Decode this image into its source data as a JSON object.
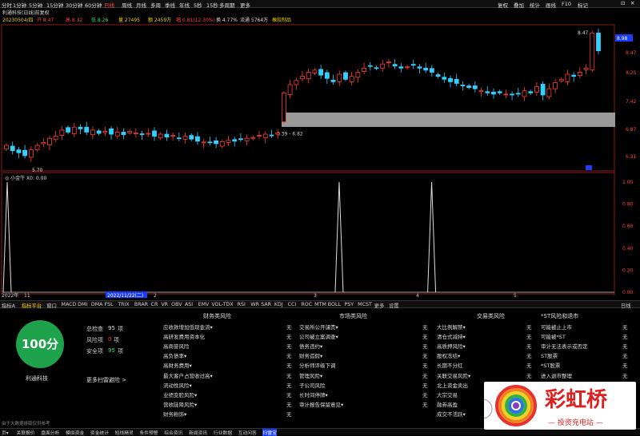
{
  "topbar": {
    "items": [
      "分时",
      "1分钟",
      "5分钟",
      "15分钟",
      "30分钟",
      "60分钟",
      "日线",
      "周线",
      "月线",
      "多周",
      "季线",
      "年线",
      "5秒",
      "15秒",
      "多周期",
      "更多"
    ],
    "selected": 6,
    "right_items": [
      "复权",
      "叠加",
      "统计",
      "画线",
      "F10",
      "标记"
    ]
  },
  "info": {
    "title": "利通科技(日线)前复权",
    "date": "20230504/四",
    "open": "开 8.47",
    "high": "高 8.32",
    "low": "低 8.26",
    "vol": "量 27495",
    "amount": "额 2459万",
    "change": "幅 0.81(12.30%)",
    "turnover": "换 4.77%",
    "float": "流通 5764万",
    "tag": "橡胶制品"
  },
  "chart_data": {
    "type": "candlestick",
    "price_axis_ticks": [
      "8.98",
      "8.47",
      "8.25",
      "7.42",
      "6.87",
      "6.31"
    ],
    "current_price_label": "8.98",
    "high_marker": "8.47",
    "low_marker": "5.70",
    "box_label": "6.39 - 6.82",
    "indicator_name": "小金牛",
    "indicator_value": "X0: 0.00",
    "indicator_axis_ticks": [
      "1.00",
      "0.80",
      "0.60",
      "0.40",
      "0.20",
      "0.00"
    ],
    "indicator_spikes": [
      1.0,
      1.0,
      1.0
    ],
    "time_labels": [
      "2022年",
      "11",
      "2022/11/22(二)",
      "2",
      "3",
      "4",
      "5"
    ],
    "closes": [
      6.18,
      6.05,
      6.0,
      5.93,
      6.07,
      6.18,
      6.25,
      6.35,
      6.4,
      6.55,
      6.5,
      6.62,
      6.58,
      6.5,
      6.55,
      6.47,
      6.52,
      6.45,
      6.5,
      6.44,
      6.52,
      6.48,
      6.44,
      6.47,
      6.4,
      6.45,
      6.38,
      6.42,
      6.35,
      6.4,
      6.33,
      6.28,
      6.26,
      6.25,
      6.22,
      6.27,
      6.3,
      6.28,
      6.33,
      6.35,
      6.37,
      6.42,
      6.45,
      6.43,
      6.48,
      7.45,
      7.65,
      7.75,
      7.85,
      7.95,
      8.0,
      7.88,
      7.8,
      7.72,
      7.9,
      7.78,
      7.85,
      7.95,
      8.05,
      8.1,
      8.05,
      8.15,
      8.2,
      8.1,
      8.05,
      8.08,
      8.12,
      8.05,
      8.0,
      7.95,
      7.85,
      7.78,
      7.72,
      7.68,
      7.62,
      7.58,
      7.55,
      7.5,
      7.45,
      7.42,
      7.45,
      7.42,
      7.4,
      7.42,
      7.5,
      7.45,
      7.6,
      7.4,
      7.55,
      7.7,
      7.78,
      7.9,
      7.85,
      7.95,
      8.05,
      8.9,
      8.47
    ]
  },
  "indicators": [
    "指标A",
    "指标平台",
    "窗口",
    "MACD",
    "DMI",
    "DMA",
    "FSL",
    "TRIX",
    "BRAR",
    "CR",
    "VR",
    "OBV",
    "ASI",
    "EMV",
    "VOL-TDX",
    "RSI",
    "WR",
    "SAR",
    "KDJ",
    "CCI",
    "ROC",
    "MTM",
    "BOLL",
    "PSY",
    "MCST",
    "更多",
    "设置"
  ],
  "indicator_selected": 1,
  "indicator_right": "日线",
  "panel": {
    "score": "100分",
    "stock_name": "利通科技",
    "total_label": "总检查",
    "total_val": "95",
    "total_unit": "项",
    "risk_label": "风险项",
    "risk_val": "0",
    "risk_unit": "项",
    "safe_label": "安全项",
    "safe_val": "95",
    "safe_unit": "项",
    "more_link": "更多扫雷避险 >",
    "footer": "由于大数据排版仅供参考",
    "columns": [
      {
        "title": "财务类风险",
        "items": [
          "应收款增加低现金流▾",
          "高研发费用资本化",
          "高商誉风险",
          "高负债率▾",
          "高财务费用▾",
          "最大客户占营收过高▾",
          "流动性风险▾",
          "业绩变脸风险▾",
          "营收陡降风险▾",
          "财务粉饰▾"
        ],
        "status": "无"
      },
      {
        "title": "市场类风险",
        "items": [
          "交易所公开谴责▾",
          "公司被立案调查▾",
          "债务违约▾",
          "财务造假▾",
          "分析师评级下调",
          "管理风险▾",
          "子公司风险",
          "长时间停牌▾",
          "审计报告保留意见▾"
        ],
        "status": "无"
      },
      {
        "title": "交易类风险",
        "items": [
          "大比例解禁▾",
          "清仓式减持▾",
          "高质押风险▾",
          "股权冻结▾",
          "长期不分红",
          "关联交易风险▾",
          "北上资金卖出",
          "大宗交易",
          "融券高盈",
          "成交不活跃▾"
        ],
        "status": "无"
      },
      {
        "title": "*ST风险和退市",
        "items": [
          "可能被止上市",
          "可能被*ST",
          "审计无法表示或否定",
          "ST股票",
          "*ST股票",
          "进入退市整理"
        ],
        "status": "无"
      }
    ]
  },
  "bottombar": [
    "页▾",
    "关联报价",
    "盘面分析",
    "模拟资金",
    "资金统计",
    "短线精灵",
    "条件预警",
    "综合资讯",
    "新闻资讯",
    "行业数据",
    "互动问答",
    "扫雷宝"
  ],
  "watermark": {
    "brand": "彩虹桥",
    "slogan": "— 投资充电站 —"
  }
}
